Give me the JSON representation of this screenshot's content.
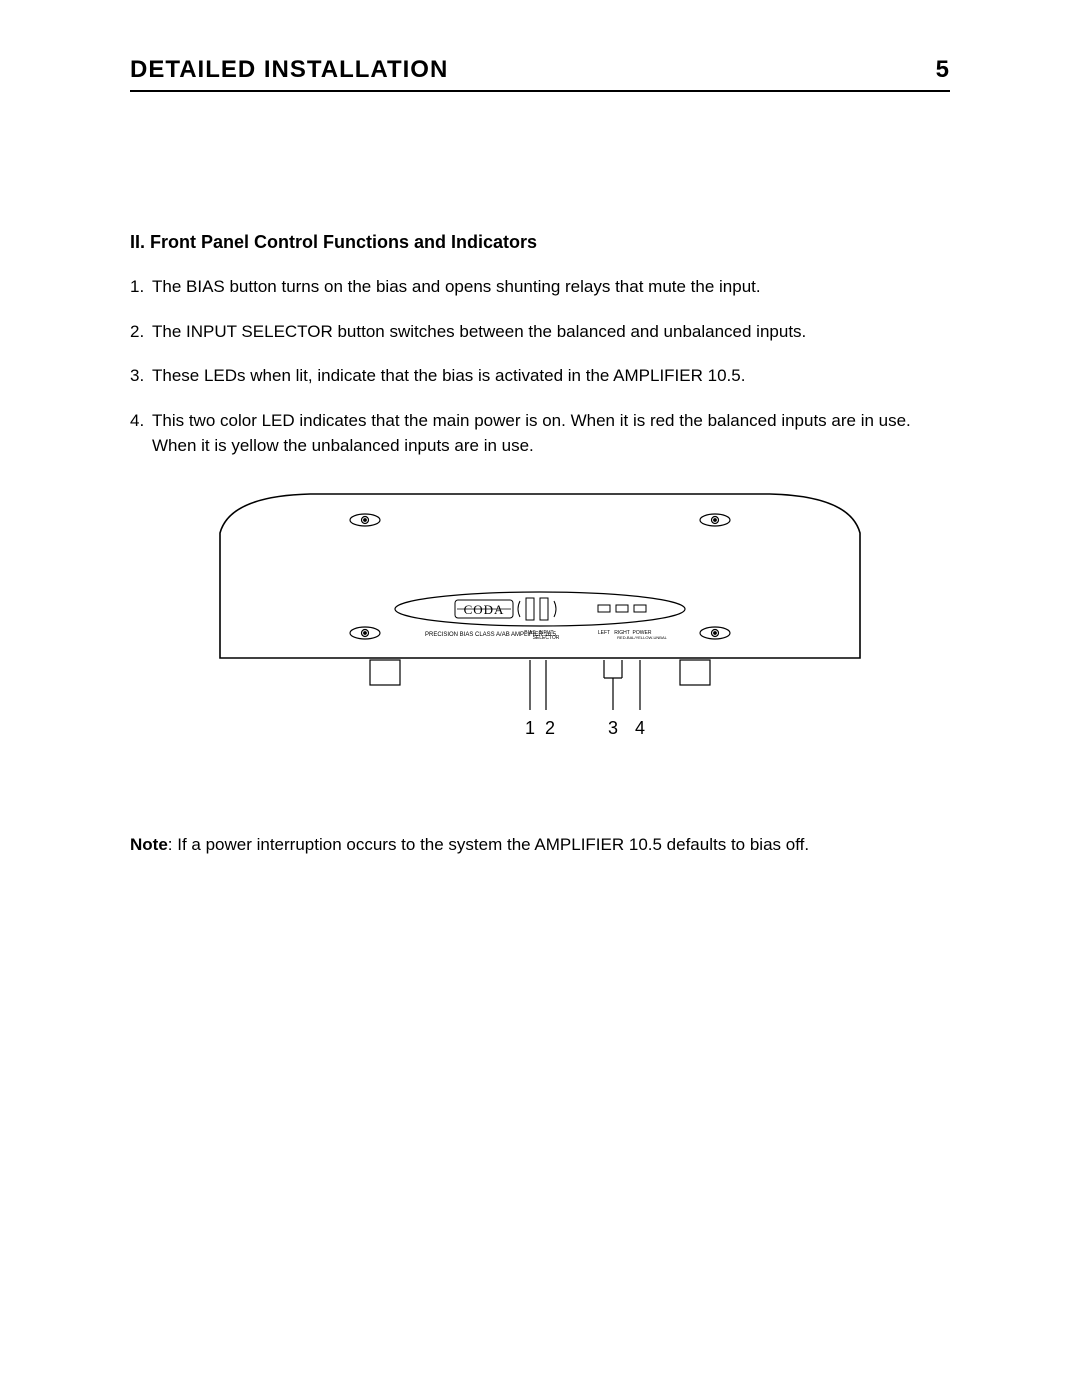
{
  "header": {
    "title": "DETAILED  INSTALLATION",
    "page_number": "5"
  },
  "section": {
    "title": "II.  Front Panel Control Functions and Indicators",
    "items": [
      {
        "num": "1.",
        "text": "The BIAS button turns on the bias and opens shunting relays that mute the input."
      },
      {
        "num": "2.",
        "text": "The INPUT SELECTOR button switches between the balanced and unbalanced inputs."
      },
      {
        "num": "3.",
        "text": "These LEDs when lit, indicate that the bias is activated in the AMPLIFIER 10.5."
      },
      {
        "num": "4.",
        "text": "This two color LED indicates that the main power is on.  When it is red the balanced inputs are in use.  When it is yellow the unbalanced inputs are in use."
      }
    ]
  },
  "diagram": {
    "brand": "CODA",
    "model_text": "PRECISION BIAS CLASS A/AB AMPLIFIER 10.5",
    "labels": {
      "bias": "BIAS",
      "input_selector": "INPUT SELECTOR",
      "left": "LEFT",
      "right": "RIGHT",
      "power": "POWER",
      "power_sub": "RED-BAL/YELLOW-UNBAL"
    },
    "callouts": [
      "1",
      "2",
      "3",
      "4"
    ]
  },
  "note": {
    "label": "Note",
    "text": ": If a power interruption occurs to the system the AMPLIFIER  10.5 defaults to bias off."
  }
}
